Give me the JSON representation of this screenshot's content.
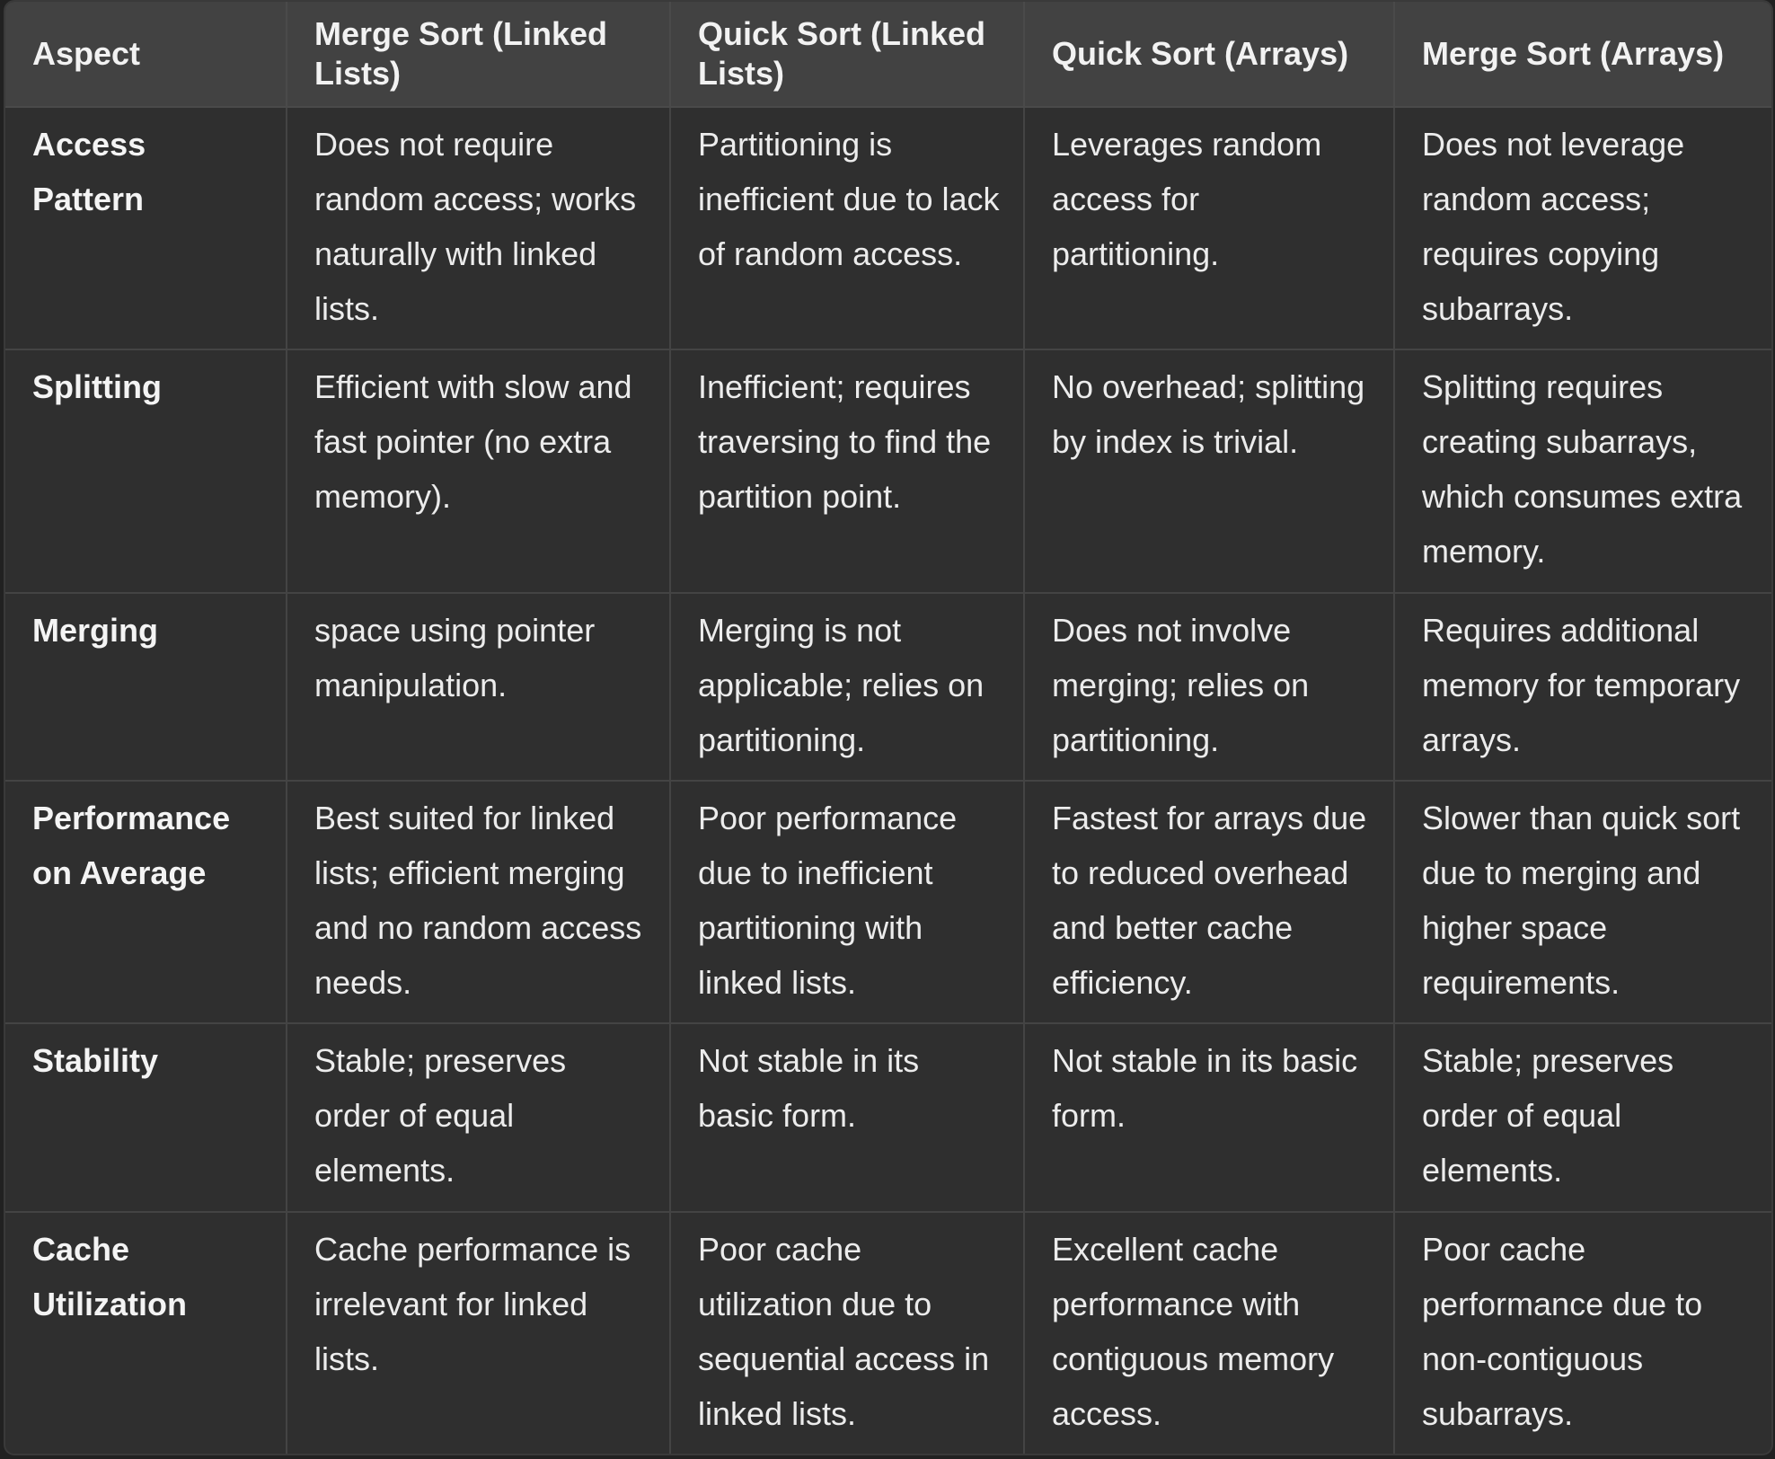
{
  "table": {
    "headers": [
      "Aspect",
      "Merge Sort (Linked Lists)",
      "Quick Sort (Linked Lists)",
      "Quick Sort (Arrays)",
      "Merge Sort (Arrays)"
    ],
    "rows": [
      [
        "Access Pattern",
        "Does not require random access; works naturally with linked lists.",
        "Partitioning is inefficient due to lack of random access.",
        "Leverages random access for partitioning.",
        "Does not leverage random access; requires copying subarrays."
      ],
      [
        "Splitting",
        "Efficient with slow and fast pointer (no extra memory).",
        "Inefficient; requires traversing to find the partition point.",
        "No overhead; splitting by index is trivial.",
        "Splitting requires creating subarrays, which consumes extra memory."
      ],
      [
        "Merging",
        "space using pointer manipulation.",
        "Merging is not applicable; relies on partitioning.",
        "Does not involve merging; relies on partitioning.",
        "Requires additional memory for temporary arrays."
      ],
      [
        "Performance on Average",
        "Best suited for linked lists; efficient merging and no random access needs.",
        "Poor performance due to inefficient partitioning with linked lists.",
        "Fastest for arrays due to reduced overhead and better cache efficiency.",
        "Slower than quick sort due to merging and higher space requirements."
      ],
      [
        "Stability",
        "Stable; preserves order of equal elements.",
        "Not stable in its basic form.",
        "Not stable in its basic form.",
        "Stable; preserves order of equal elements."
      ],
      [
        "Cache Utilization",
        "Cache performance is irrelevant for linked lists.",
        "Poor cache utilization due to sequential access in linked lists.",
        "Excellent cache performance with contiguous memory access.",
        "Poor cache performance due to non-contiguous subarrays."
      ]
    ]
  }
}
